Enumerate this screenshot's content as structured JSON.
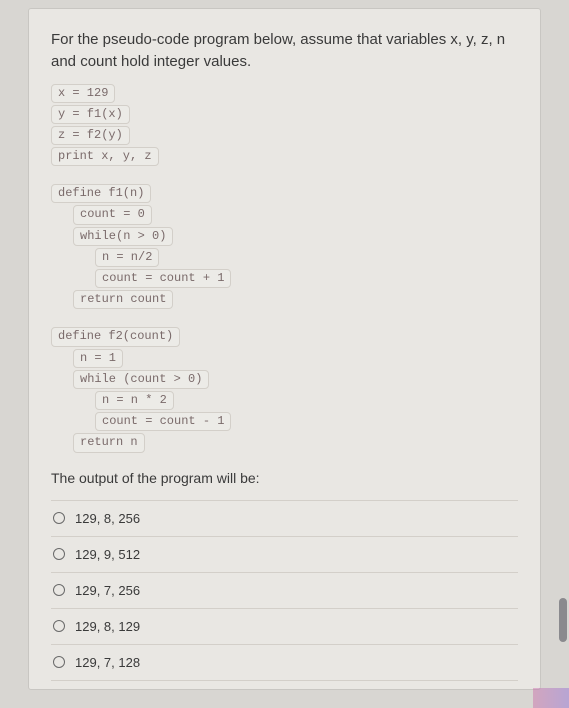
{
  "question": {
    "stem": "For the pseudo-code program below, assume that variables x, y, z, n and count hold integer values.",
    "code1": [
      "x = 129",
      "y = f1(x)",
      "z = f2(y)",
      "print x, y, z"
    ],
    "code2": {
      "h": "define f1(n)",
      "l1": "count = 0",
      "l2": "while(n > 0)",
      "l3": "n = n/2",
      "l4": "count = count + 1",
      "r": "return count"
    },
    "code3": {
      "h": "define f2(count)",
      "l1": "n = 1",
      "l2": "while (count > 0)",
      "l3": "n = n * 2",
      "l4": "count = count - 1",
      "r": "return n"
    },
    "prompt2": "The output of the program will be:"
  },
  "answers": [
    "129, 8, 256",
    "129, 9, 512",
    "129, 7, 256",
    "129, 8, 129",
    "129, 7, 128"
  ]
}
